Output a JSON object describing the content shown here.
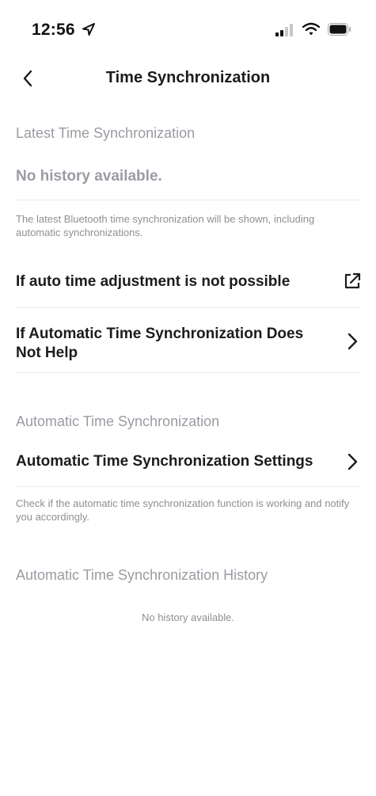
{
  "status_bar": {
    "time": "12:56",
    "icons": [
      "location-arrow-icon",
      "cellular-signal-icon",
      "wifi-icon",
      "battery-icon"
    ]
  },
  "nav": {
    "back_icon": "chevron-left-icon",
    "title": "Time Synchronization"
  },
  "latest": {
    "header": "Latest Time Synchronization",
    "value": "No history available.",
    "caption": "The latest Bluetooth time synchronization will be shown, including automatic synchronizations."
  },
  "help_rows": [
    {
      "label": "If auto time adjustment is not possible",
      "icon": "external-link-icon"
    },
    {
      "label": "If Automatic Time Synchronization Does Not Help",
      "icon": "chevron-right-icon"
    }
  ],
  "automatic": {
    "header": "Automatic Time Synchronization",
    "settings_label": "Automatic Time Synchronization Settings",
    "settings_icon": "chevron-right-icon",
    "caption": "Check if the automatic time synchronization function is working and notify you accordingly."
  },
  "history": {
    "header": "Automatic Time Synchronization History",
    "empty_text": "No history available."
  },
  "colors": {
    "primary_text": "#1c1c1e",
    "muted_text": "#9a9ca3",
    "divider": "#e9eaee",
    "background": "#ffffff"
  }
}
